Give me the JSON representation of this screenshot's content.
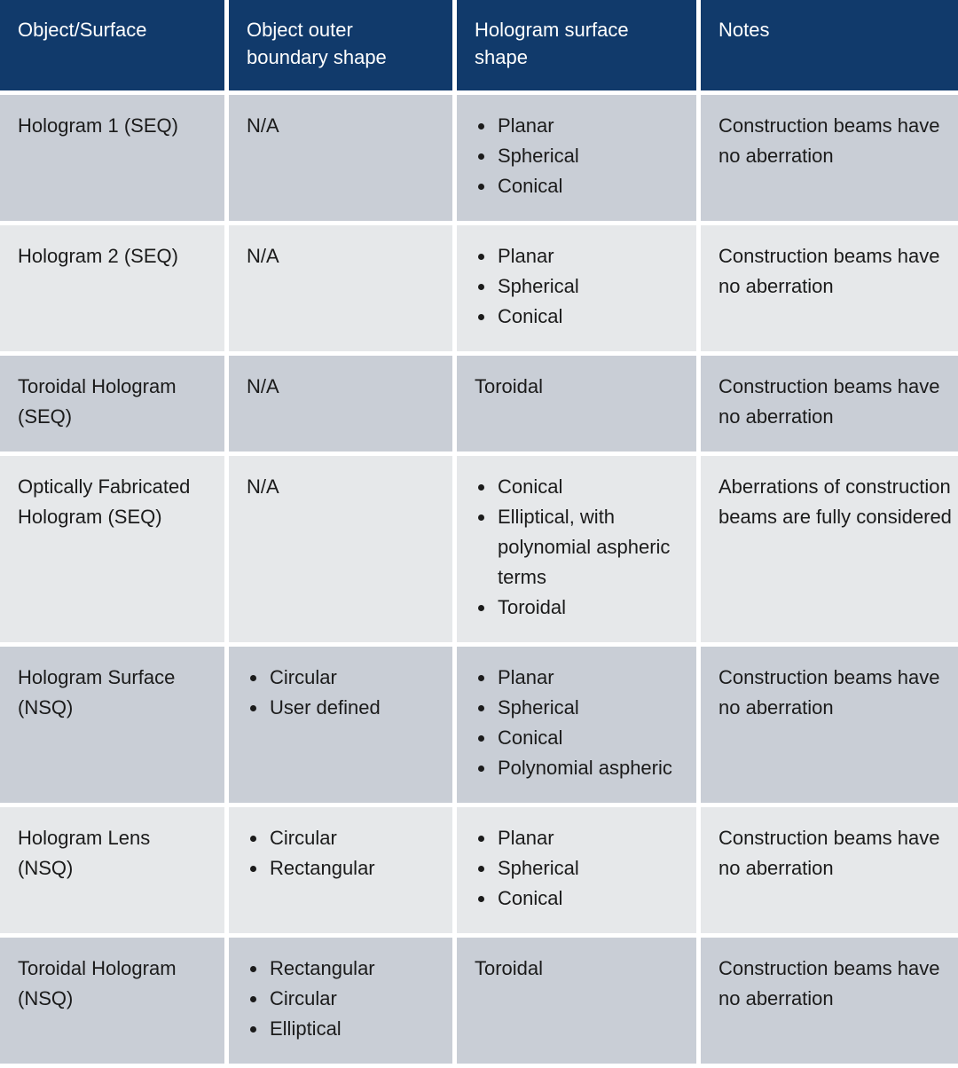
{
  "table": {
    "columns": [
      {
        "key": "object_surface",
        "label": "Object/Surface"
      },
      {
        "key": "outer_boundary",
        "label": "Object outer boundary shape"
      },
      {
        "key": "hologram_surface",
        "label": "Hologram surface shape"
      },
      {
        "key": "notes",
        "label": "Notes"
      }
    ],
    "colors": {
      "header_background": "#113A6B",
      "header_text": "#FFFFFF",
      "row_band_dark": "#C9CED6",
      "row_band_light": "#E6E8EA",
      "body_text": "#1B1B1B",
      "page_background": "#FFFFFF"
    },
    "rows": [
      {
        "band": "dark",
        "object_surface": "Hologram 1 (SEQ)",
        "outer_boundary_text": "N/A",
        "outer_boundary_bullets": [],
        "hologram_surface_text": "",
        "hologram_surface_bullets": [
          "Planar",
          "Spherical",
          "Conical"
        ],
        "notes": "Construction beams have no aberration"
      },
      {
        "band": "light",
        "object_surface": "Hologram 2 (SEQ)",
        "outer_boundary_text": "N/A",
        "outer_boundary_bullets": [],
        "hologram_surface_text": "",
        "hologram_surface_bullets": [
          "Planar",
          "Spherical",
          "Conical"
        ],
        "notes": "Construction beams have no aberration"
      },
      {
        "band": "dark",
        "object_surface": "Toroidal Hologram (SEQ)",
        "outer_boundary_text": "N/A",
        "outer_boundary_bullets": [],
        "hologram_surface_text": "Toroidal",
        "hologram_surface_bullets": [],
        "notes": "Construction beams have no aberration"
      },
      {
        "band": "light",
        "object_surface": "Optically Fabricated Hologram (SEQ)",
        "outer_boundary_text": "N/A",
        "outer_boundary_bullets": [],
        "hologram_surface_text": "",
        "hologram_surface_bullets": [
          "Conical",
          "Elliptical, with polynomial aspheric terms",
          "Toroidal"
        ],
        "notes": "Aberrations of construction beams are fully considered"
      },
      {
        "band": "dark",
        "object_surface": "Hologram Surface (NSQ)",
        "outer_boundary_text": "",
        "outer_boundary_bullets": [
          "Circular",
          "User defined"
        ],
        "hologram_surface_text": "",
        "hologram_surface_bullets": [
          "Planar",
          "Spherical",
          "Conical",
          "Polynomial aspheric"
        ],
        "notes": "Construction beams have no aberration"
      },
      {
        "band": "light",
        "object_surface": "Hologram Lens (NSQ)",
        "outer_boundary_text": "",
        "outer_boundary_bullets": [
          "Circular",
          "Rectangular"
        ],
        "hologram_surface_text": "",
        "hologram_surface_bullets": [
          "Planar",
          "Spherical",
          "Conical"
        ],
        "notes": "Construction beams have no aberration"
      },
      {
        "band": "dark",
        "object_surface": "Toroidal Hologram (NSQ)",
        "outer_boundary_text": "",
        "outer_boundary_bullets": [
          "Rectangular",
          "Circular",
          "Elliptical"
        ],
        "hologram_surface_text": "Toroidal",
        "hologram_surface_bullets": [],
        "notes": "Construction beams have no aberration"
      }
    ]
  }
}
